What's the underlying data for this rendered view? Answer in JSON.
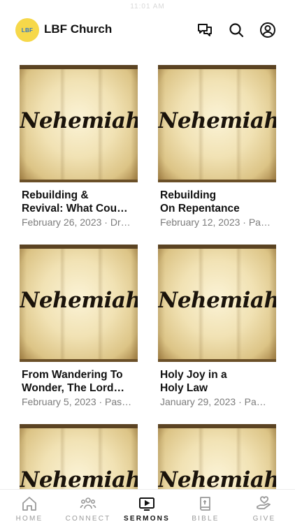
{
  "status_bar": {
    "time": "11:01 AM"
  },
  "header": {
    "logo_text": "LBF",
    "title": "LBF Church",
    "icons": [
      "chat-icon",
      "search-icon",
      "profile-icon"
    ]
  },
  "sermons": [
    {
      "thumb_text": "Nehemiah",
      "title": "Rebuilding &\nRevival: What Cou…",
      "meta": "February 26, 2023 · Dr…"
    },
    {
      "thumb_text": "Nehemiah",
      "title": "Rebuilding\nOn Repentance",
      "meta": "February 12, 2023 · Pa…"
    },
    {
      "thumb_text": "Nehemiah",
      "title": "From Wandering To\nWonder, The Lord…",
      "meta": "February 5, 2023 · Pas…"
    },
    {
      "thumb_text": "Nehemiah",
      "title": "Holy Joy in a\nHoly Law",
      "meta": "January 29, 2023 · Pa…"
    },
    {
      "thumb_text": "Nehemiah",
      "title": "",
      "meta": ""
    },
    {
      "thumb_text": "Nehemiah",
      "title": "",
      "meta": ""
    }
  ],
  "tabbar": {
    "items": [
      {
        "label": "HOME",
        "icon": "home-icon",
        "active": false
      },
      {
        "label": "CONNECT",
        "icon": "people-icon",
        "active": false
      },
      {
        "label": "SERMONS",
        "icon": "video-icon",
        "active": true
      },
      {
        "label": "BIBLE",
        "icon": "book-icon",
        "active": false
      },
      {
        "label": "GIVE",
        "icon": "give-icon",
        "active": false
      }
    ]
  },
  "colors": {
    "accent": "#111111",
    "inactive": "#9a9a9a",
    "logo_bg": "#f6d84a",
    "logo_fg": "#2f74c8"
  }
}
